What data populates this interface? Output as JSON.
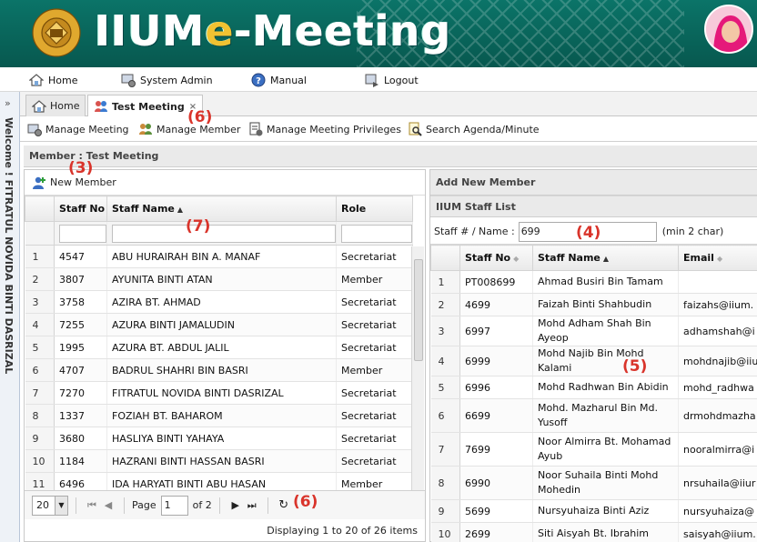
{
  "header": {
    "app_title_prefix": "IIUM",
    "app_title_e": "e",
    "app_title_suffix": "-Meeting"
  },
  "topmenu": {
    "home": "Home",
    "system_admin": "System Admin",
    "manual": "Manual",
    "logout": "Logout"
  },
  "sidebar": {
    "welcome_text": "Welcome ! FITRATUL NOVIDA BINTI DASRIZAL"
  },
  "tabs": {
    "home": "Home",
    "test_meeting": "Test Meeting",
    "close": "×"
  },
  "toolbar": {
    "manage_meeting": "Manage Meeting",
    "manage_member": "Manage Member",
    "manage_privileges": "Manage Meeting Privileges",
    "search_agenda": "Search Agenda/Minute"
  },
  "member_panel": {
    "title": "Member : Test Meeting",
    "new_member": "New Member",
    "columns": [
      "Staff No",
      "Staff Name",
      "Role"
    ],
    "rows": [
      [
        "1",
        "4547",
        "ABU HURAIRAH BIN A. MANAF",
        "Secretariat"
      ],
      [
        "2",
        "3807",
        "AYUNITA BINTI ATAN",
        "Member"
      ],
      [
        "3",
        "3758",
        "AZIRA BT. AHMAD",
        "Secretariat"
      ],
      [
        "4",
        "7255",
        "AZURA BINTI JAMALUDIN",
        "Secretariat"
      ],
      [
        "5",
        "1995",
        "AZURA BT. ABDUL JALIL",
        "Secretariat"
      ],
      [
        "6",
        "4707",
        "BADRUL SHAHRI BIN BASRI",
        "Member"
      ],
      [
        "7",
        "7270",
        "FITRATUL NOVIDA BINTI DASRIZAL",
        "Secretariat"
      ],
      [
        "8",
        "1337",
        "FOZIAH BT. BAHAROM",
        "Secretariat"
      ],
      [
        "9",
        "3680",
        "HASLIYA BINTI YAHAYA",
        "Secretariat"
      ],
      [
        "10",
        "1184",
        "HAZRANI BINTI HASSAN BASRI",
        "Secretariat"
      ],
      [
        "11",
        "6496",
        "IDA HARYATI BINTI ABU HASAN",
        "Member"
      ]
    ],
    "pager": {
      "page_size": "20",
      "page_label": "Page",
      "page_value": "1",
      "of_label": "of 2"
    },
    "displaying": "Displaying 1 to 20 of 26 items"
  },
  "add_panel": {
    "title": "Add New Member",
    "staff_list_title": "IIUM Staff List",
    "search_label": "Staff # / Name :",
    "search_value": "699",
    "search_hint": "(min 2 char)",
    "columns": [
      "Staff No",
      "Staff Name",
      "Email"
    ],
    "rows": [
      [
        "1",
        "PT008699",
        "Ahmad Busiri Bin Tamam",
        ""
      ],
      [
        "2",
        "4699",
        "Faizah Binti Shahbudin",
        "faizahs@iium."
      ],
      [
        "3",
        "6997",
        "Mohd Adham Shah Bin Ayeop",
        "adhamshah@i"
      ],
      [
        "4",
        "6999",
        "Mohd Najib Bin Mohd Kalami",
        "mohdnajib@iiu"
      ],
      [
        "5",
        "6996",
        "Mohd Radhwan Bin Abidin",
        "mohd_radhwa"
      ],
      [
        "6",
        "6699",
        "Mohd. Mazharul Bin Md. Yusoff",
        "drmohdmazha"
      ],
      [
        "7",
        "7699",
        "Noor Almirra Bt. Mohamad Ayub",
        "nooralmirra@i"
      ],
      [
        "8",
        "6990",
        "Noor Suhaila Binti Mohd Mohedin",
        "nrsuhaila@iiur"
      ],
      [
        "9",
        "5699",
        "Nursyuhaiza Binti Aziz",
        "nursyuhaiza@"
      ],
      [
        "10",
        "2699",
        "Siti Aisyah Bt. Ibrahim",
        "saisyah@iium."
      ]
    ]
  },
  "annotations": {
    "a3": "(3)",
    "a4": "(4)",
    "a5": "(5)",
    "a6_top": "(6)",
    "a6_pager": "(6)",
    "a7": "(7)"
  }
}
